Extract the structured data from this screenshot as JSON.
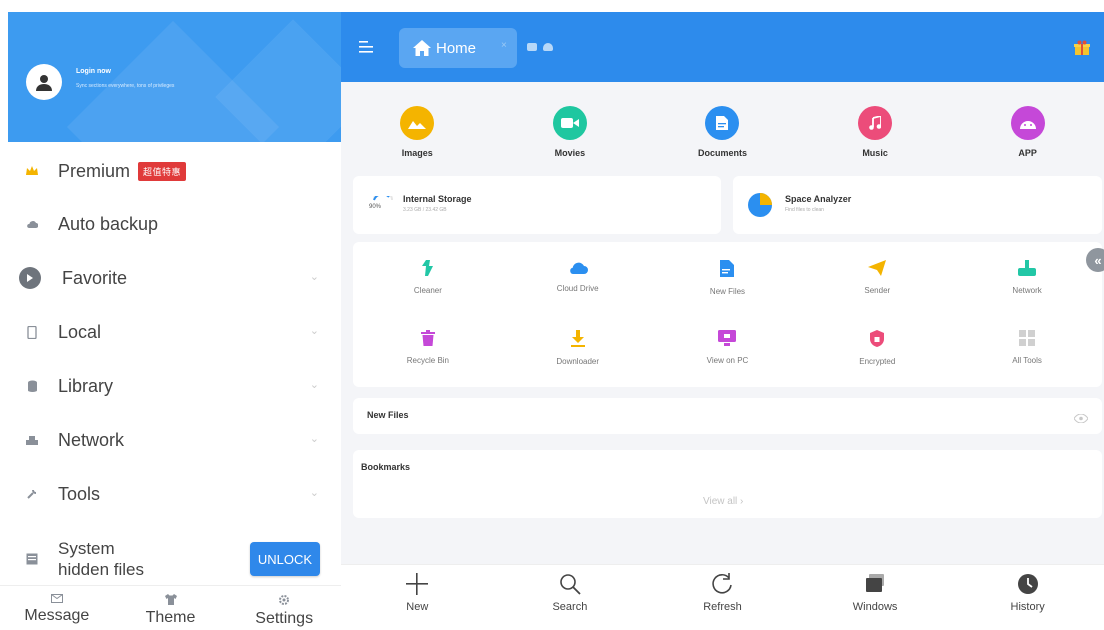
{
  "sidebar": {
    "header": {
      "login": "Login now",
      "subtitle": "Sync sections everywhere, tons of privileges"
    },
    "items": [
      {
        "label": "Premium",
        "badge": "超值特惠",
        "icon": "crown-icon"
      },
      {
        "label": "Auto backup",
        "icon": "cloud-icon"
      },
      {
        "label": "Favorite",
        "icon": "star-icon"
      },
      {
        "label": "Local",
        "icon": "phone-icon"
      },
      {
        "label": "Library",
        "icon": "library-icon"
      },
      {
        "label": "Network",
        "icon": "network-icon"
      },
      {
        "label": "Tools",
        "icon": "wrench-icon"
      }
    ],
    "system_hidden": {
      "label_line1": "System",
      "label_line2": "hidden files",
      "button": "UNLOCK"
    },
    "bottom": [
      {
        "label": "Message",
        "icon": "message-icon"
      },
      {
        "label": "Theme",
        "icon": "shirt-icon"
      },
      {
        "label": "Settings",
        "icon": "gear-icon"
      }
    ]
  },
  "topbar": {
    "home_tab": "Home",
    "close_glyph": "×"
  },
  "categories": [
    {
      "label": "Images",
      "color": "#f4b400",
      "icon": "image-icon"
    },
    {
      "label": "Movies",
      "color": "#1fc7a0",
      "icon": "video-icon"
    },
    {
      "label": "Documents",
      "color": "#2b8ff0",
      "icon": "document-icon"
    },
    {
      "label": "Music",
      "color": "#ec4c7a",
      "icon": "music-icon"
    },
    {
      "label": "APP",
      "color": "#c548d8",
      "icon": "app-icon"
    }
  ],
  "storage": {
    "internal": {
      "title": "Internal Storage",
      "subtitle": "3.23 GB / 23.42 GB",
      "percent_label": "90%"
    },
    "analyzer": {
      "title": "Space Analyzer",
      "subtitle": "Find files to clean"
    }
  },
  "tools": [
    {
      "label": "Cleaner",
      "color": "#22c7a6",
      "icon": "broom-icon"
    },
    {
      "label": "Cloud Drive",
      "color": "#2b8ff0",
      "icon": "cloud-drive-icon"
    },
    {
      "label": "New Files",
      "color": "#2b8ff0",
      "icon": "new-file-icon"
    },
    {
      "label": "Sender",
      "color": "#f4b400",
      "icon": "paper-plane-icon"
    },
    {
      "label": "Network",
      "color": "#22c7a6",
      "icon": "network-tool-icon"
    },
    {
      "label": "Recycle Bin",
      "color": "#c548d8",
      "icon": "trash-icon"
    },
    {
      "label": "Downloader",
      "color": "#f4b400",
      "icon": "download-icon"
    },
    {
      "label": "View on PC",
      "color": "#c548d8",
      "icon": "monitor-icon"
    },
    {
      "label": "Encrypted",
      "color": "#ec4c7a",
      "icon": "shield-lock-icon"
    },
    {
      "label": "All Tools",
      "color": "#c8c8c8",
      "icon": "grid-icon"
    }
  ],
  "sections": {
    "new_files": "New Files",
    "bookmarks": "Bookmarks",
    "view_all": "View all ›"
  },
  "bottom_bar": [
    {
      "label": "New",
      "icon": "plus-icon"
    },
    {
      "label": "Search",
      "icon": "search-icon"
    },
    {
      "label": "Refresh",
      "icon": "refresh-icon"
    },
    {
      "label": "Windows",
      "icon": "windows-stack-icon"
    },
    {
      "label": "History",
      "icon": "clock-icon"
    }
  ],
  "colors": {
    "accent": "#2d8bec",
    "sidebar_header": "#3d9bf0",
    "badge": "#e03a3a",
    "unlock": "#2f88ea"
  }
}
